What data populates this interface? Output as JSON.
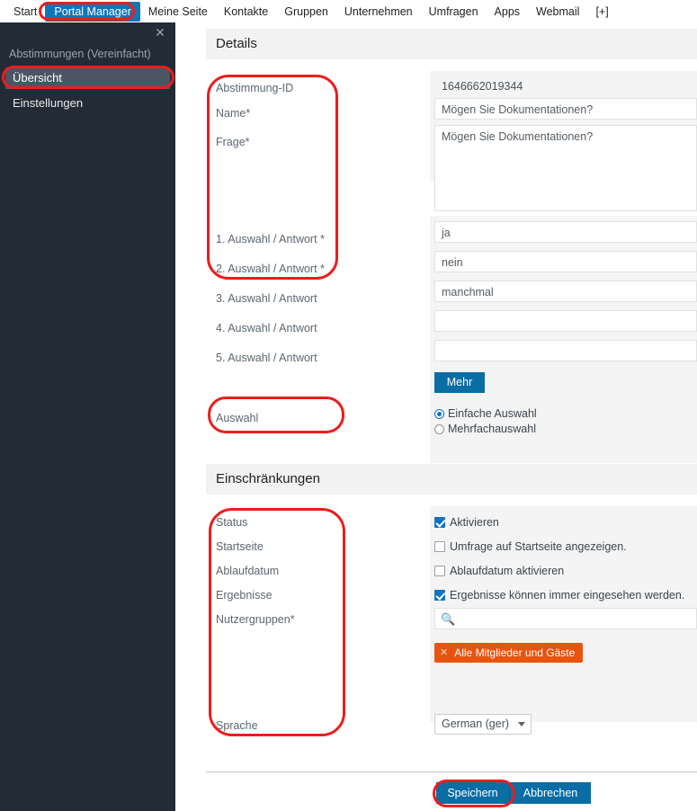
{
  "topnav": {
    "items": [
      {
        "label": "Start",
        "active": false
      },
      {
        "label": "Portal Manager",
        "active": true
      },
      {
        "label": "Meine Seite",
        "active": false
      },
      {
        "label": "Kontakte",
        "active": false
      },
      {
        "label": "Gruppen",
        "active": false
      },
      {
        "label": "Unternehmen",
        "active": false
      },
      {
        "label": "Umfragen",
        "active": false
      },
      {
        "label": "Apps",
        "active": false
      },
      {
        "label": "Webmail",
        "active": false
      },
      {
        "label": "[+]",
        "active": false
      }
    ]
  },
  "sidebar": {
    "close_label": "✕",
    "title": "Abstimmungen (Vereinfacht)",
    "items": [
      {
        "label": "Übersicht",
        "selected": true
      },
      {
        "label": "Einstellungen",
        "selected": false
      }
    ]
  },
  "details": {
    "heading": "Details",
    "labels": {
      "id": "Abstimmung-ID",
      "name": "Name*",
      "frage": "Frage*",
      "answer1": "1. Auswahl / Antwort *",
      "answer2": "2. Auswahl / Antwort *",
      "answer3": "3. Auswahl / Antwort",
      "answer4": "4. Auswahl / Antwort",
      "answer5": "5. Auswahl / Antwort",
      "auswahl": "Auswahl"
    },
    "values": {
      "id": "1646662019344",
      "name": "Mögen Sie Dokumentationen?",
      "frage": "Mögen Sie Dokumentationen?",
      "answer1": "ja",
      "answer2": "nein",
      "answer3": "manchmal",
      "answer4": "",
      "answer5": ""
    },
    "more_button": "Mehr",
    "auswahl_options": [
      {
        "label": "Einfache Auswahl",
        "selected": true
      },
      {
        "label": "Mehrfachauswahl",
        "selected": false
      }
    ]
  },
  "einschraenkungen": {
    "heading": "Einschränkungen",
    "labels": {
      "status": "Status",
      "startseite": "Startseite",
      "ablaufdatum": "Ablaufdatum",
      "ergebnisse": "Ergebnisse",
      "nutzergruppen": "Nutzergruppen*",
      "sprache": "Sprache"
    },
    "checkboxes": [
      {
        "label": "Aktivieren",
        "checked": true
      },
      {
        "label": "Umfrage auf Startseite angezeigen.",
        "checked": false
      },
      {
        "label": "Ablaufdatum aktivieren",
        "checked": false
      },
      {
        "label": "Ergebnisse können immer eingesehen werden.",
        "checked": true
      }
    ],
    "search_value": "",
    "search_icon": "search-zoom-in-icon",
    "group_tag": {
      "remove": "✕",
      "label": "Alle Mitglieder und Gäste"
    },
    "language": "German (ger)"
  },
  "footer": {
    "save_label": "Speichern",
    "cancel_label": "Abbrechen"
  },
  "colors": {
    "nav_active": "#1176b8",
    "primary_button": "#0a6da4",
    "tag": "#e8540e",
    "annotation": "#ee1c1c",
    "sidebar_bg": "#232b36"
  }
}
